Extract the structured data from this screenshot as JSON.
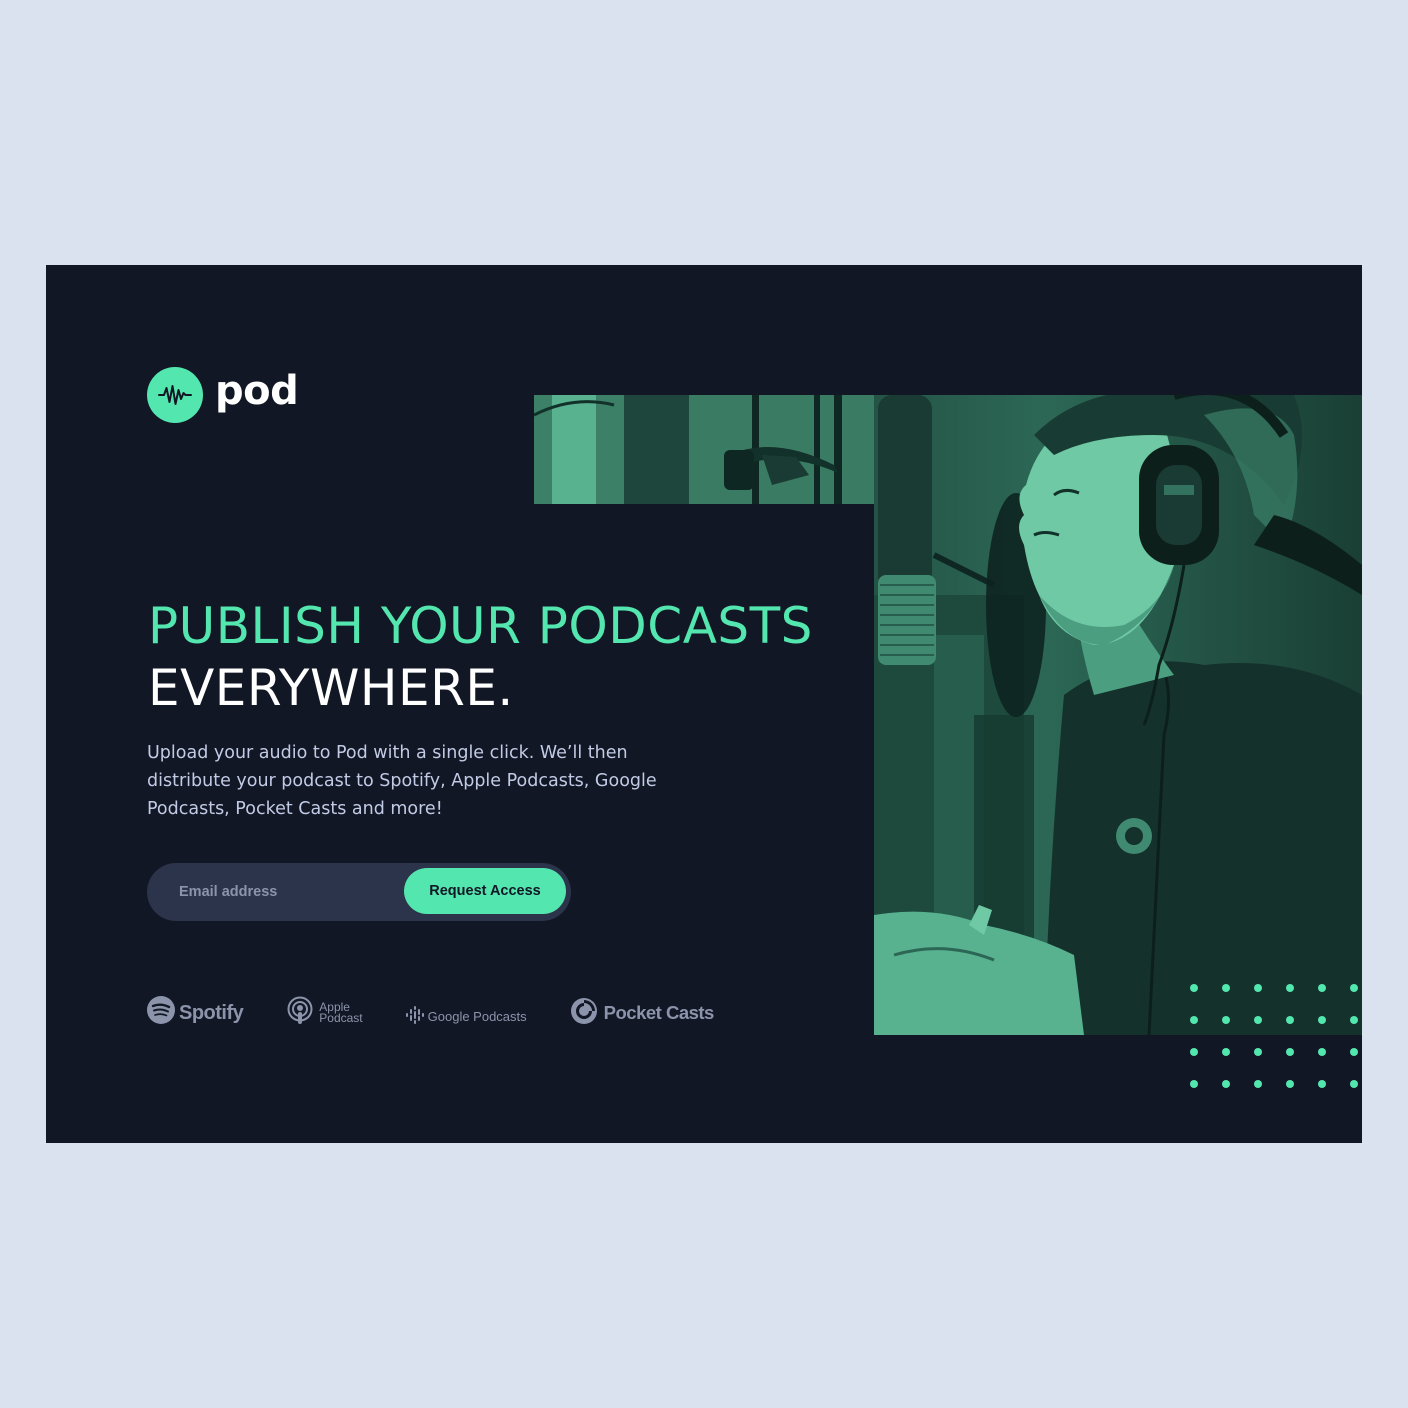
{
  "brand": {
    "name": "pod"
  },
  "hero": {
    "headline_accent": "PUBLISH YOUR PODCASTS",
    "headline_main": "EVERYWHERE.",
    "description": "Upload your audio to Pod with a single click. We’ll then distribute your podcast to Spotify, Apple Podcasts, Google Podcasts, Pocket Casts and more!"
  },
  "signup": {
    "email_placeholder": "Email address",
    "submit_label": "Request Access"
  },
  "platforms": [
    {
      "name": "Spotify",
      "icon": "spotify-icon"
    },
    {
      "name_line1": "Apple",
      "name_line2": "Podcast",
      "icon": "apple-podcast-icon"
    },
    {
      "name": "Google Podcasts",
      "icon": "google-podcasts-icon"
    },
    {
      "name": "Pocket Casts",
      "icon": "pocket-casts-icon"
    }
  ],
  "colors": {
    "page_background": "#d9e2ee",
    "frame_background": "#121725",
    "accent": "#54e6af",
    "muted_text": "#8c94ab",
    "body_text": "#c2cbe5",
    "input_background": "#2c344b"
  }
}
